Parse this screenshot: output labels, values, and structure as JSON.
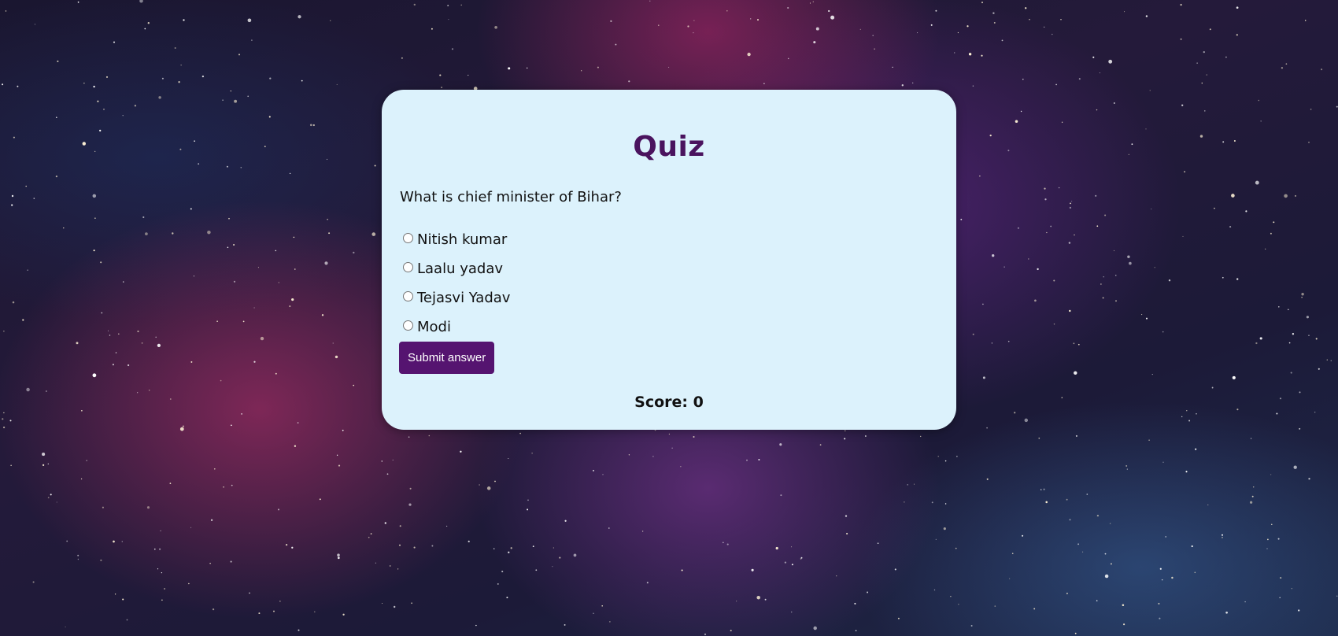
{
  "quiz": {
    "title": "Quiz",
    "question": "What is chief minister of Bihar?",
    "options": [
      {
        "label": "Nitish kumar",
        "selected": false
      },
      {
        "label": "Laalu yadav",
        "selected": false
      },
      {
        "label": "Tejasvi Yadav",
        "selected": false
      },
      {
        "label": "Modi",
        "selected": false
      }
    ],
    "submit_label": "Submit answer",
    "score_text": "Score: 0"
  },
  "colors": {
    "card_background": "#dcf2fc",
    "title": "#4a135e",
    "button": "#551470"
  }
}
